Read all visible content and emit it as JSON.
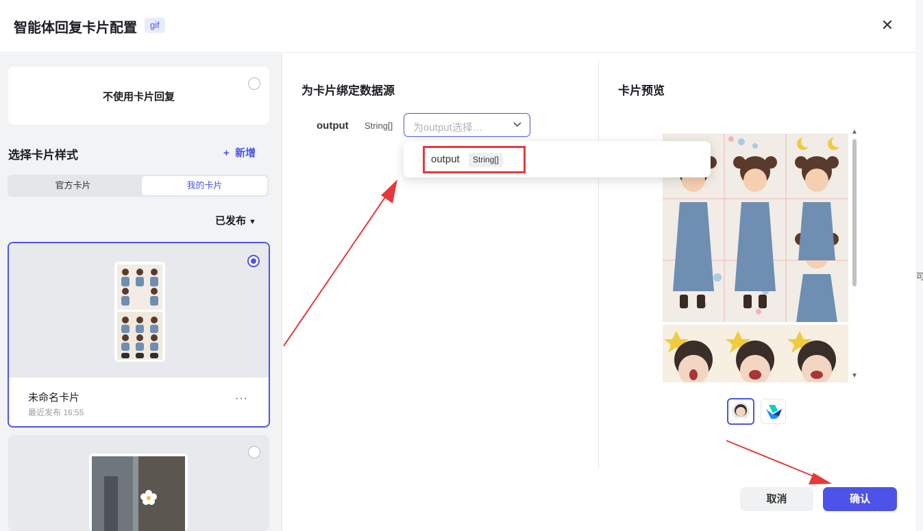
{
  "header": {
    "title": "智能体回复卡片配置",
    "tag": "gif"
  },
  "left": {
    "no_card_label": "不使用卡片回复",
    "section_title": "选择卡片样式",
    "add_label": "新增",
    "tabs": [
      "官方卡片",
      "我的卡片"
    ],
    "filter_label": "已发布",
    "cards": [
      {
        "name": "未命名卡片",
        "meta": "最近发布 16:55"
      }
    ]
  },
  "middle": {
    "title": "为卡片绑定数据源",
    "field_name": "output",
    "field_type": "String[]",
    "select_placeholder": "为output选择…",
    "option_name": "output",
    "option_type": "String[]"
  },
  "right": {
    "title": "卡片预览",
    "cancel": "取消",
    "confirm": "确认"
  },
  "edge_char": "可",
  "colors": {
    "accent": "#4d53e8",
    "annotation": "#e53a3a"
  }
}
